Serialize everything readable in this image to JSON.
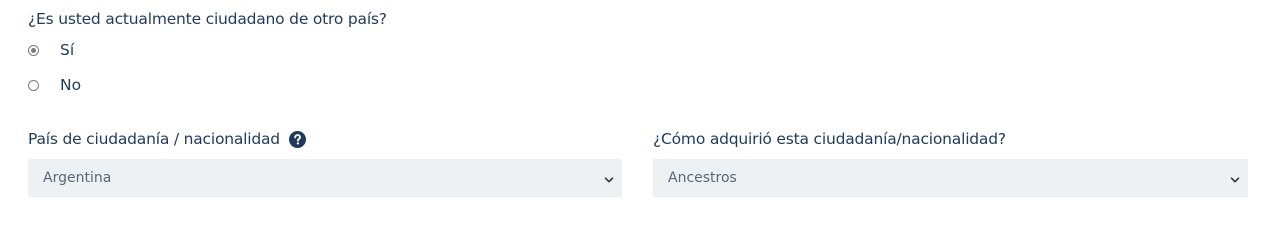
{
  "citizenship_question": {
    "label": "¿Es usted actualmente ciudadano de otro país?",
    "options": [
      {
        "label": "Sí",
        "selected": true
      },
      {
        "label": "No",
        "selected": false
      }
    ]
  },
  "country_field": {
    "label": "País de ciudadanía / nacionalidad",
    "help_icon": "question-circle-icon",
    "selected_value": "Argentina"
  },
  "acquisition_field": {
    "label": "¿Cómo adquirió esta ciudadanía/nacionalidad?",
    "selected_value": "Ancestros"
  },
  "colors": {
    "text": "#1f3a5c",
    "select_bg": "#eef1f4",
    "select_text": "#5b6775"
  }
}
